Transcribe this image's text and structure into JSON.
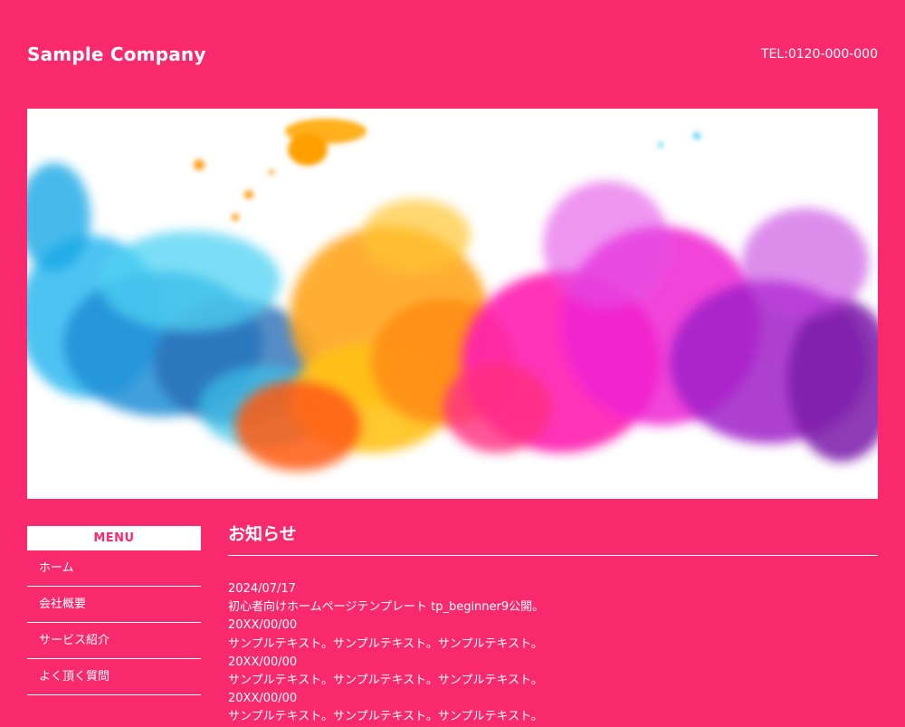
{
  "header": {
    "logo": "Sample Company",
    "tel": "TEL:0120-000-000"
  },
  "hero": {
    "image": "colorful-ink-smoke-image"
  },
  "menu": {
    "title": "MENU",
    "items": [
      {
        "label": "ホーム"
      },
      {
        "label": "会社概要"
      },
      {
        "label": "サービス紹介"
      },
      {
        "label": "よく頂く質問"
      }
    ]
  },
  "news": {
    "title": "お知らせ",
    "items": [
      {
        "date": "2024/07/17",
        "text": "初心者向けホームページテンプレート tp_beginner9公開。"
      },
      {
        "date": "20XX/00/00",
        "text": "サンプルテキスト。サンプルテキスト。サンプルテキスト。"
      },
      {
        "date": "20XX/00/00",
        "text": "サンプルテキスト。サンプルテキスト。サンプルテキスト。"
      },
      {
        "date": "20XX/00/00",
        "text": "サンプルテキスト。サンプルテキスト。サンプルテキスト。"
      }
    ]
  },
  "colors": {
    "background": "#f8296d",
    "text": "#ffffff",
    "menu_title_text": "#f8296d"
  }
}
